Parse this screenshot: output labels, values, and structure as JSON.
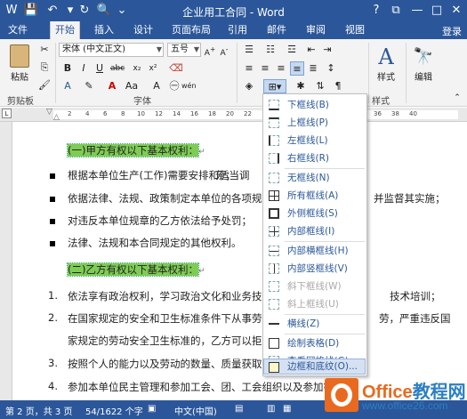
{
  "window": {
    "title": "企业用工合同 - Word"
  },
  "quick_access": {
    "save_icon": "save-icon",
    "undo_icon": "undo-icon",
    "redo_icon": "redo-icon",
    "preview_icon": "print-preview-icon"
  },
  "window_controls": {
    "help": "?",
    "ribbon_options": "⧉",
    "minimize": "—",
    "maximize": "□",
    "close": "✕"
  },
  "tabs": [
    {
      "label": "文件"
    },
    {
      "label": "开始"
    },
    {
      "label": "插入"
    },
    {
      "label": "设计"
    },
    {
      "label": "页面布局"
    },
    {
      "label": "引用"
    },
    {
      "label": "邮件"
    },
    {
      "label": "审阅"
    },
    {
      "label": "视图"
    }
  ],
  "signin": "登录",
  "ribbon": {
    "clipboard": {
      "paste": "粘贴",
      "label": "剪贴板"
    },
    "font": {
      "name": "宋体 (中文正文)",
      "size": "五号",
      "label": "字体",
      "wen": "wén",
      "a_label": "A"
    },
    "paragraph": {
      "label": "段落"
    },
    "styles": {
      "big": "样式",
      "label": "样式"
    },
    "editing": {
      "big": "编辑"
    }
  },
  "ruler": {
    "numbers": [
      "2",
      "4",
      "6",
      "8",
      "10",
      "12",
      "14",
      "16",
      "18",
      "20",
      "22",
      "24",
      "26",
      "28",
      "30",
      "32",
      "34",
      "36",
      "38",
      "40"
    ]
  },
  "document": {
    "heading1": "(一)甲方有权以下基本权利：",
    "bullets": [
      "根据本单位生产(工作)需要安排和适当调",
      "依据法律、法规、政策制定本单位的各项规",
      "对违反本单位规章的乙方依法给予处罚；",
      "法律、法规和本合同规定的其他权利。"
    ],
    "bullet_tails": [
      "芳；",
      "并监督其实施；"
    ],
    "heading2": "(二)乙方有权以下基本权利：",
    "numbered": [
      {
        "n": "1.",
        "text": "依法享有政治权利，学习政治文化和业务技",
        "tail": "技术培训；"
      },
      {
        "n": "2.",
        "text": "在国家规定的安全和卫生标准条件下从事劳",
        "tail": "劳，严重违反国"
      },
      {
        "n": "",
        "text": "家规定的劳动安全卫生标准的，乙方可以拒",
        "tail": ""
      },
      {
        "n": "3.",
        "text": "按照个人的能力以及劳动的数量、质量获取",
        "tail": ""
      },
      {
        "n": "4.",
        "text": "参加本单位民主管理和参加工会、团、工会组织以及参加等",
        "tail": ""
      }
    ]
  },
  "border_menu": {
    "items": [
      {
        "label": "下框线(B)",
        "disabled": false
      },
      {
        "label": "上框线(P)",
        "disabled": false
      },
      {
        "label": "左框线(L)",
        "disabled": false
      },
      {
        "label": "右框线(R)",
        "disabled": false
      },
      {
        "label": "无框线(N)",
        "disabled": false
      },
      {
        "label": "所有框线(A)",
        "disabled": false
      },
      {
        "label": "外侧框线(S)",
        "disabled": false
      },
      {
        "label": "内部框线(I)",
        "disabled": false
      },
      {
        "label": "内部横框线(H)",
        "disabled": false
      },
      {
        "label": "内部竖框线(V)",
        "disabled": false
      },
      {
        "label": "斜下框线(W)",
        "disabled": true
      },
      {
        "label": "斜上框线(U)",
        "disabled": true
      },
      {
        "label": "横线(Z)",
        "disabled": false
      },
      {
        "label": "绘制表格(D)",
        "disabled": false
      },
      {
        "label": "查看网格线(G)",
        "disabled": false
      },
      {
        "label": "边框和底纹(O)...",
        "disabled": false
      }
    ]
  },
  "status": {
    "page": "第 2 页，共 3 页",
    "words": "54/1622 个字",
    "lang": "中文(中国)"
  },
  "watermark": {
    "brand_a": "Office",
    "brand_b": "教程网",
    "site": "www.office26.com"
  },
  "colors": {
    "accent": "#2b579a",
    "highlight": "#7fcc55",
    "menu_text": "#2b579a",
    "watermark_orange": "#e96a1e"
  }
}
